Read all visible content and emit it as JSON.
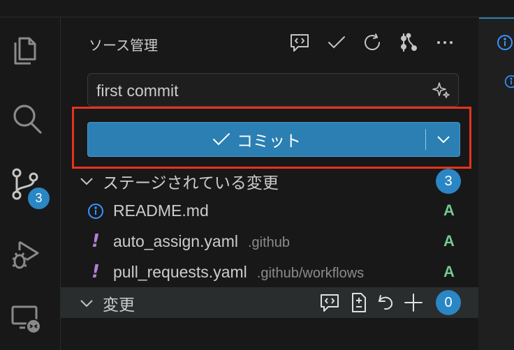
{
  "source_control": {
    "title": "ソース管理",
    "commit_message": "first commit",
    "commit_label": "コミット"
  },
  "activity_bar": {
    "scm_badge": "3"
  },
  "staged": {
    "header": "ステージされている変更",
    "count": "3",
    "files": [
      {
        "name": "README.md",
        "dir": "",
        "status": "A",
        "icon": "info-icon"
      },
      {
        "name": "auto_assign.yaml",
        "dir": ".github",
        "status": "A",
        "icon": "exclamation-icon"
      },
      {
        "name": "pull_requests.yaml",
        "dir": ".github/workflows",
        "status": "A",
        "icon": "exclamation-icon"
      }
    ]
  },
  "changes": {
    "header": "変更",
    "count": "0"
  },
  "colors": {
    "accent": "#2b7fb3",
    "added": "#73c991",
    "warning": "#b180d7",
    "info": "#3794ff",
    "highlight": "#e8331b"
  }
}
